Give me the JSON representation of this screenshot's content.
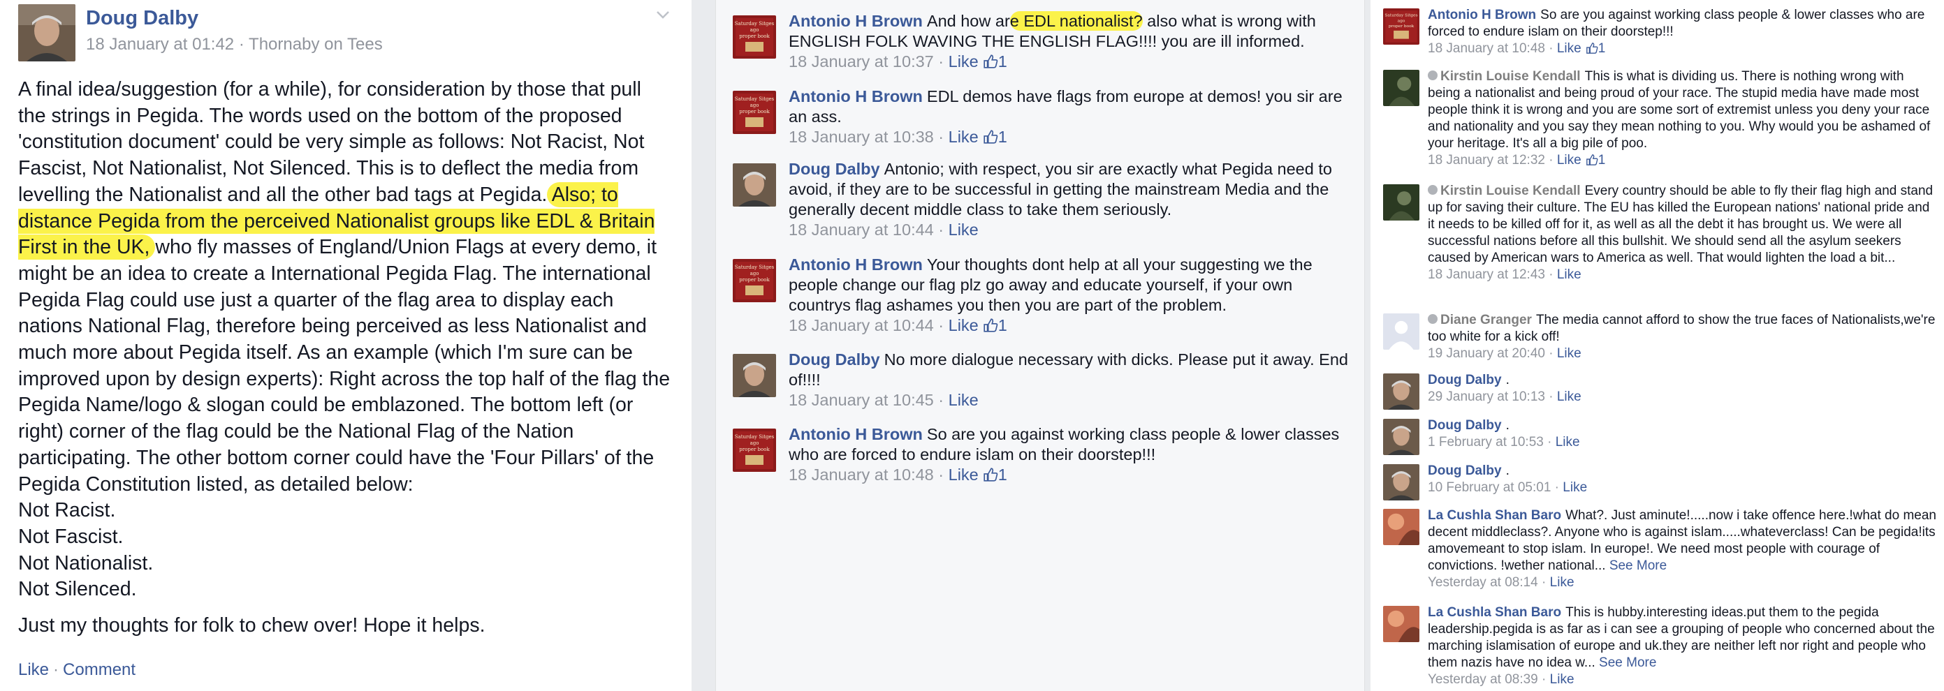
{
  "post": {
    "author": "Doug Dalby",
    "meta": "18 January at 01:42 · Thornaby on Tees",
    "body_before_highlight": "A final idea/suggestion (for a while), for consideration by those that pull the strings in Pegida. The words used on the bottom of the proposed 'constitution document' could be very simple as follows: Not Racist, Not Fascist, Not Nationalist, Not Silenced. This is to deflect the media from levelling the Nationalist and all the other bad tags at Pegida.",
    "body_highlight": " Also; to distance Pegida from the perceived Nationalist groups like EDL & Britain First in the UK, ",
    "body_after_highlight": "who fly masses of England/Union Flags at every demo, it might be an idea to create a International Pegida Flag. The international Pegida Flag could use just a quarter of the flag area to display each nations National Flag, therefore being perceived as less Nationalist and much more about Pegida itself. As an example (which I'm sure can be improved upon by design experts): Right across the top half of the flag the Pegida Name/logo & slogan could be emblazoned. The bottom left (or right) corner of the flag could be the National Flag of the Nation participating. The other bottom corner could have the 'Four Pillars' of the Pegida Constitution listed, as detailed below:",
    "list": [
      "Not Racist.",
      "Not Fascist.",
      "Not Nationalist.",
      "Not Silenced."
    ],
    "closing": "Just my thoughts for folk to chew over! Hope it helps.",
    "like_label": "Like",
    "comment_label": "Comment"
  },
  "middle_comments": [
    {
      "author": "Antonio H Brown",
      "avatar": "book",
      "text_a": "And how ar",
      "text_hl": "e EDL nationalist?",
      "text_b": " also what is wrong with ENGLISH FOLK WAVING THE ENGLISH FLAG!!!! you are ill informed.",
      "time": "18 January at 10:37",
      "like": "Like",
      "likes": "1"
    },
    {
      "author": "Antonio H Brown",
      "avatar": "book",
      "text_a": "EDL demos have flags from europe at demos! you sir are an ass.",
      "time": "18 January at 10:38",
      "like": "Like",
      "likes": "1"
    },
    {
      "author": "Doug Dalby",
      "avatar": "man",
      "text_a": "Antonio; with respect, you sir are exactly what Pegida need to avoid, if they are to be successful in getting the mainstream Media and the generally decent middle class to take them seriously.",
      "time": "18 January at 10:44",
      "like": "Like",
      "likes": ""
    },
    {
      "author": "Antonio H Brown",
      "avatar": "book",
      "text_a": "Your thoughts dont help at all your suggesting we the people change our flag plz go away and educate yourself, if your own countrys flag ashames you then you are part of the problem.",
      "time": "18 January at 10:44",
      "like": "Like",
      "likes": "1"
    },
    {
      "author": "Doug Dalby",
      "avatar": "man",
      "text_a": "No more dialogue necessary with dicks. Please put it away. End of!!!!",
      "time": "18 January at 10:45",
      "like": "Like",
      "likes": ""
    },
    {
      "author": "Antonio H Brown",
      "avatar": "book",
      "text_a": "So are you against working class people & lower classes who are forced to endure islam on their doorstep!!!",
      "time": "18 January at 10:48",
      "like": "Like",
      "likes": "1"
    }
  ],
  "right_comments": [
    {
      "author": "Antonio H Brown",
      "avatar": "book",
      "grey": false,
      "text": "So are you against working class people & lower classes who are forced to endure islam on their doorstep!!!",
      "time": "18 January at 10:48",
      "like": "Like",
      "likes": "1",
      "see_more": ""
    },
    {
      "author": "Kirstin Louise Kendall",
      "avatar": "dark",
      "grey": true,
      "text": "This is what is dividing us. There is nothing wrong with being a nationalist and being proud of your race. The stupid media have made most people think it is wrong and you are some sort of extremist unless you deny your race and nationality and you say they mean nothing to you. Why would you be ashamed of your heritage. It's all a big pile of poo.",
      "time": "18 January at 12:32",
      "like": "Like",
      "likes": "1",
      "see_more": ""
    },
    {
      "author": "Kirstin Louise Kendall",
      "avatar": "dark",
      "grey": true,
      "text": "Every country should be able to fly their flag high and stand up for saving their culture. The EU has killed the European nations' national pride and it needs to be killed off for it, as well as all the debt it has brought us. We were all successful nations before all this bullshit. We should send all the asylum seekers caused by American wars to America as well. That would lighten the load a bit...",
      "time": "18 January at 12:43",
      "like": "Like",
      "likes": "",
      "see_more": ""
    },
    {
      "author": "Diane Granger",
      "avatar": "blank",
      "grey": true,
      "text": "The media cannot afford to show the true faces of Nationalists,we're too white for a kick off!",
      "time": "19 January at 20:40",
      "like": "Like",
      "likes": "",
      "see_more": ""
    },
    {
      "author": "Doug Dalby",
      "avatar": "man",
      "grey": false,
      "text": ".",
      "time": "29 January at 10:13",
      "like": "Like",
      "likes": "",
      "see_more": ""
    },
    {
      "author": "Doug Dalby",
      "avatar": "man",
      "grey": false,
      "text": ".",
      "time": "1 February at 10:53",
      "like": "Like",
      "likes": "",
      "see_more": ""
    },
    {
      "author": "Doug Dalby",
      "avatar": "man",
      "grey": false,
      "text": ".",
      "time": "10 February at 05:01",
      "like": "Like",
      "likes": "",
      "see_more": ""
    },
    {
      "author": "La Cushla Shan Baro",
      "avatar": "red",
      "grey": false,
      "text": "What?. Just aminute!.....now i take offence here.!what do mean decent middleclass?. Anyone who is against islam.....whateverclass! Can be pegida!its amovemeant to stop islam. In europe!. We need most people with courage of convictions. !wether national...",
      "time": "Yesterday at 08:14",
      "like": "Like",
      "likes": "",
      "see_more": "See More"
    },
    {
      "author": "La Cushla Shan Baro",
      "avatar": "red",
      "grey": false,
      "text": "This is hubby.interesting ideas.put them to the pegida leadership.pegida is as far as i can see a grouping of people who concerned about the marching islamisation of europe and uk.they are neither left nor right and people who them nazis have no idea w...",
      "time": "Yesterday at 08:39",
      "like": "Like",
      "likes": "",
      "see_more": "See More"
    }
  ],
  "book_avatar_text": [
    "Saturday",
    "Sitges",
    "ago",
    "proper",
    "book"
  ],
  "colors": {
    "link": "#3b5998",
    "meta": "#90949c",
    "highlight": "#fbf24a",
    "panel_bg": "#f6f7f9"
  },
  "icons": [
    "chevron-down-icon",
    "thumbs-up-icon",
    "avatar-photo"
  ]
}
